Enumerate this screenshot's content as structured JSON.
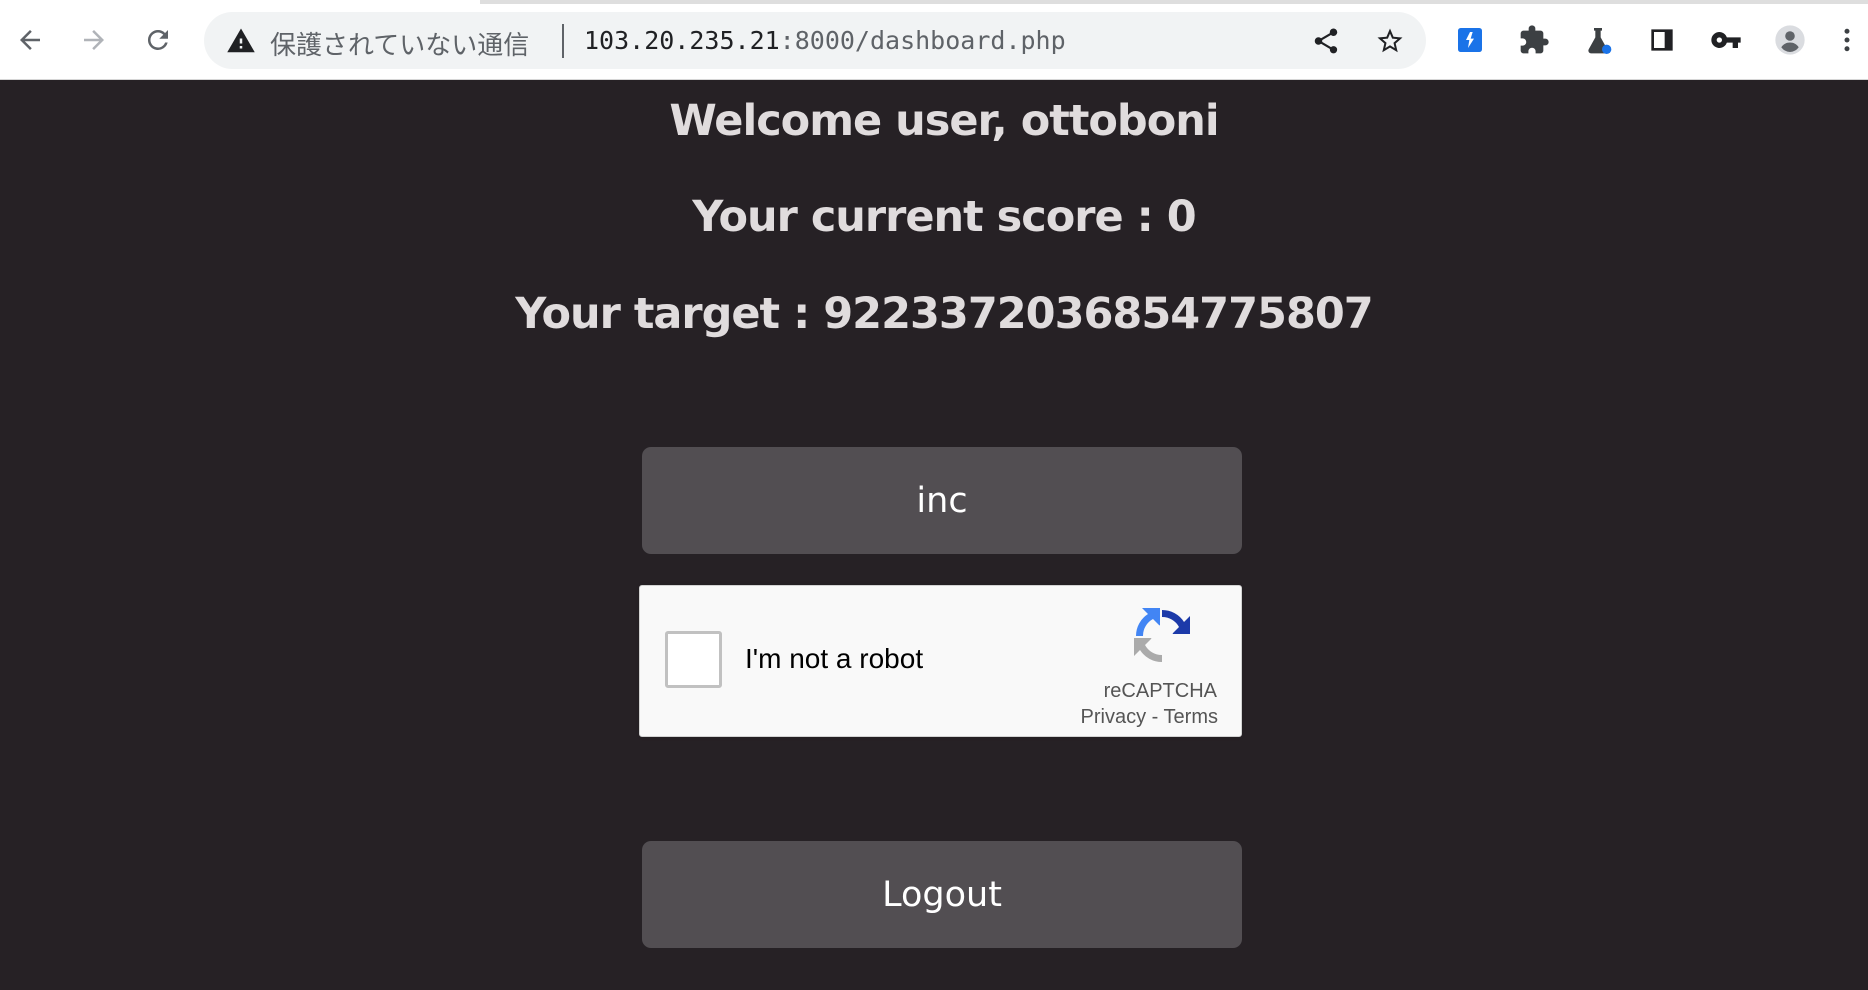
{
  "browser": {
    "security_label": "保護されていない通信",
    "url_host": "103.20.235.21",
    "url_rest": ":8000/dashboard.php",
    "icons": {
      "back": "arrow-left-icon",
      "forward": "arrow-right-icon",
      "reload": "reload-icon",
      "warning": "warning-triangle-icon",
      "share": "share-icon",
      "bookmark": "star-icon",
      "extension_1": "blue-extension-icon",
      "extensions": "puzzle-icon",
      "labs": "flask-icon",
      "side_panel": "side-panel-icon",
      "passwords": "key-icon",
      "profile": "person-icon",
      "menu": "kebab-menu-icon"
    }
  },
  "page": {
    "welcome": "Welcome user, ottoboni",
    "score": "Your current score : 0",
    "target": "Your target : 9223372036854775807",
    "inc_button": "inc",
    "logout_button": "Logout"
  },
  "recaptcha": {
    "label": "I'm not a robot",
    "brand": "reCAPTCHA",
    "privacy": "Privacy",
    "separator": " - ",
    "terms": "Terms"
  },
  "colors": {
    "page_background": "#262125",
    "heading_text": "#e0dcdd",
    "button_background": "#524e52",
    "button_text": "#ffffff",
    "extension_blue": "#1a73e8"
  }
}
